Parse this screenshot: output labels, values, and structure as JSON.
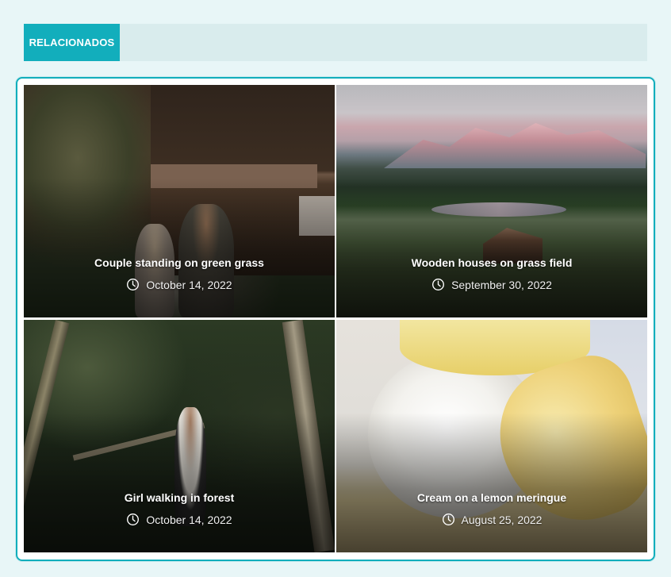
{
  "section": {
    "title": "RELACIONADOS"
  },
  "posts": [
    {
      "title": "Couple standing on green grass",
      "date": "October 14, 2022",
      "image": "couple-barn-photo"
    },
    {
      "title": "Wooden houses on grass field",
      "date": "September 30, 2022",
      "image": "alpine-lake-photo"
    },
    {
      "title": "Girl walking in forest",
      "date": "October 14, 2022",
      "image": "forest-girl-photo"
    },
    {
      "title": "Cream on a lemon meringue",
      "date": "August 25, 2022",
      "image": "lemon-meringue-photo"
    }
  ],
  "icons": {
    "date": "clock-icon"
  },
  "colors": {
    "accent": "#12aebc",
    "header_bar": "#d9eced",
    "page_bg": "#e8f6f7"
  }
}
